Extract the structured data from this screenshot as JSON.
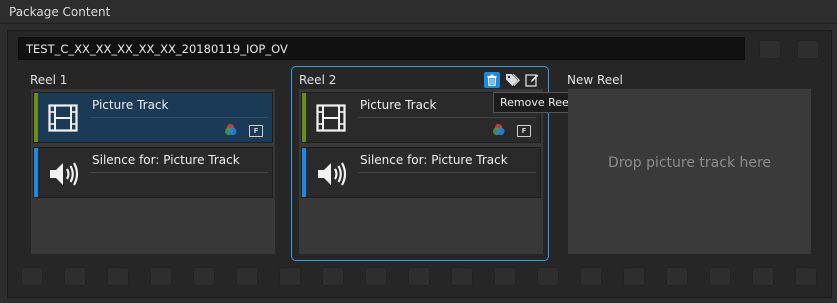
{
  "header": {
    "title": "Package Content"
  },
  "package": {
    "name": "TEST_C_XX_XX_XX_XX_XX_20180119_IOP_OV"
  },
  "reels": [
    {
      "label": "Reel 1",
      "tracks": [
        {
          "title": "Picture Track",
          "type": "picture",
          "selected": true
        },
        {
          "title": "Silence for: Picture Track",
          "type": "audio",
          "selected": false
        }
      ]
    },
    {
      "label": "Reel 2",
      "tracks": [
        {
          "title": "Picture Track",
          "type": "picture",
          "selected": false
        },
        {
          "title": "Silence for: Picture Track",
          "type": "audio",
          "selected": false
        }
      ],
      "tools": [
        "trash-icon",
        "tag-icon",
        "edit-icon"
      ]
    }
  ],
  "new_reel": {
    "label": "New Reel",
    "drop_hint": "Drop picture track here"
  },
  "tooltip": {
    "text": "Remove Reel"
  },
  "badge_letter": "F",
  "colors": {
    "accent_blue": "#1e88e5",
    "picture_bar": "#6e8b1a",
    "audio_bar": "#1e88e5",
    "selection": "#1b3a56",
    "focus_border": "#3a9ae0"
  }
}
